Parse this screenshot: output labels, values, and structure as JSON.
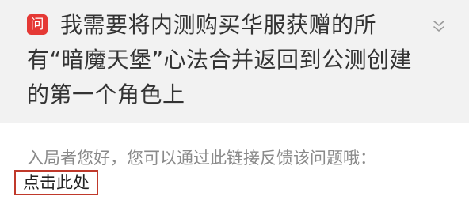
{
  "question": {
    "badge": "问",
    "title": "我需要将内测购买华服获赠的所有“暗魔天堡”心法合并返回到公测创建的第一个角色上"
  },
  "answer": {
    "intro": "入局者您好，您可以通过此链接反馈该问题哦：",
    "link_label": "点击此处"
  },
  "colors": {
    "badge_bg": "#e53935",
    "card_bg": "#f2f2f2",
    "link_border": "#c0392b"
  },
  "icons": {
    "expand": "chevron-double-down-icon"
  }
}
